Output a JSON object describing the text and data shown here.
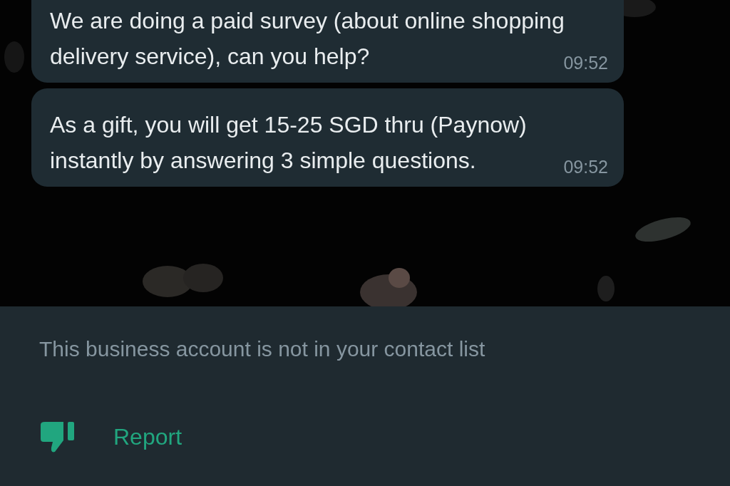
{
  "messages": [
    {
      "text": "We are doing a paid survey (about online shopping delivery service), can you help?",
      "time": "09:52"
    },
    {
      "text": "As a gift, you will get 15-25 SGD thru (Paynow) instantly by answering 3 simple questions.",
      "time": "09:52"
    }
  ],
  "notice": "This business account is not in your contact list",
  "actions": [
    {
      "label": "Report"
    }
  ]
}
